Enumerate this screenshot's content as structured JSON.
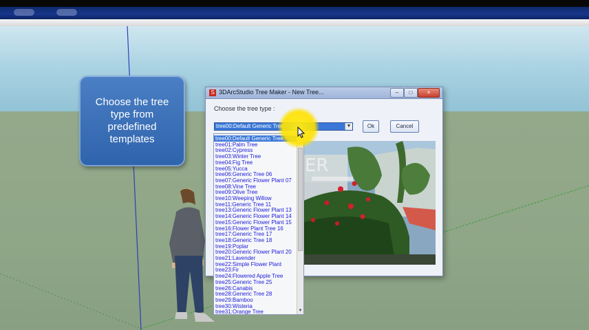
{
  "callout": {
    "text": "Choose the tree\ntype from\npredefined\ntemplates"
  },
  "dialog": {
    "title": "3DArcStudio Tree Maker - New Tree...",
    "prompt": "Choose the tree type :",
    "selected_value": "tree00:Default Generic Tree",
    "ok_label": "Ok",
    "cancel_label": "Cancel",
    "window_buttons": {
      "minimize": "–",
      "maximize": "□",
      "close": "×"
    },
    "app_icon": "S"
  },
  "dropdown": {
    "options": [
      "tree00:Default Generic Tree",
      "tree01:Palm Tree",
      "tree02:Cypress",
      "tree03:Winter Tree",
      "tree04:Fig Tree",
      "tree05:Yucca",
      "tree06:Generic Tree 06",
      "tree07:Generic Flower Plant 07",
      "tree08:Vine Tree",
      "tree09:Olive Tree",
      "tree10:Weeping Willow",
      "tree11:Generic Tree 11",
      "tree13:Generic Flower Plant 13",
      "tree14:Generic Flower Plant 14",
      "tree15:Generic Flower Plant 15",
      "tree16:Flower Plant Tree 16",
      "tree17:Generic Tree 17",
      "tree18:Generic Tree 18",
      "tree19:Poplar",
      "tree20:Generic Flower Plant 20",
      "tree21:Lavender",
      "tree22:Simple Flower Plant",
      "tree23:Fir",
      "tree24:Flowered Apple Tree",
      "tree25:Generic Tree 25",
      "tree26:Canabis",
      "tree28:Generic Tree 28",
      "tree29:Bamboo",
      "tree30:Wisteria",
      "tree31:Orange Tree"
    ],
    "selected_index": 0
  },
  "preview": {
    "watermark": "ER"
  },
  "colors": {
    "selection": "#3a78d8",
    "callout": "#3a6fba",
    "highlight": "#ffe600"
  }
}
